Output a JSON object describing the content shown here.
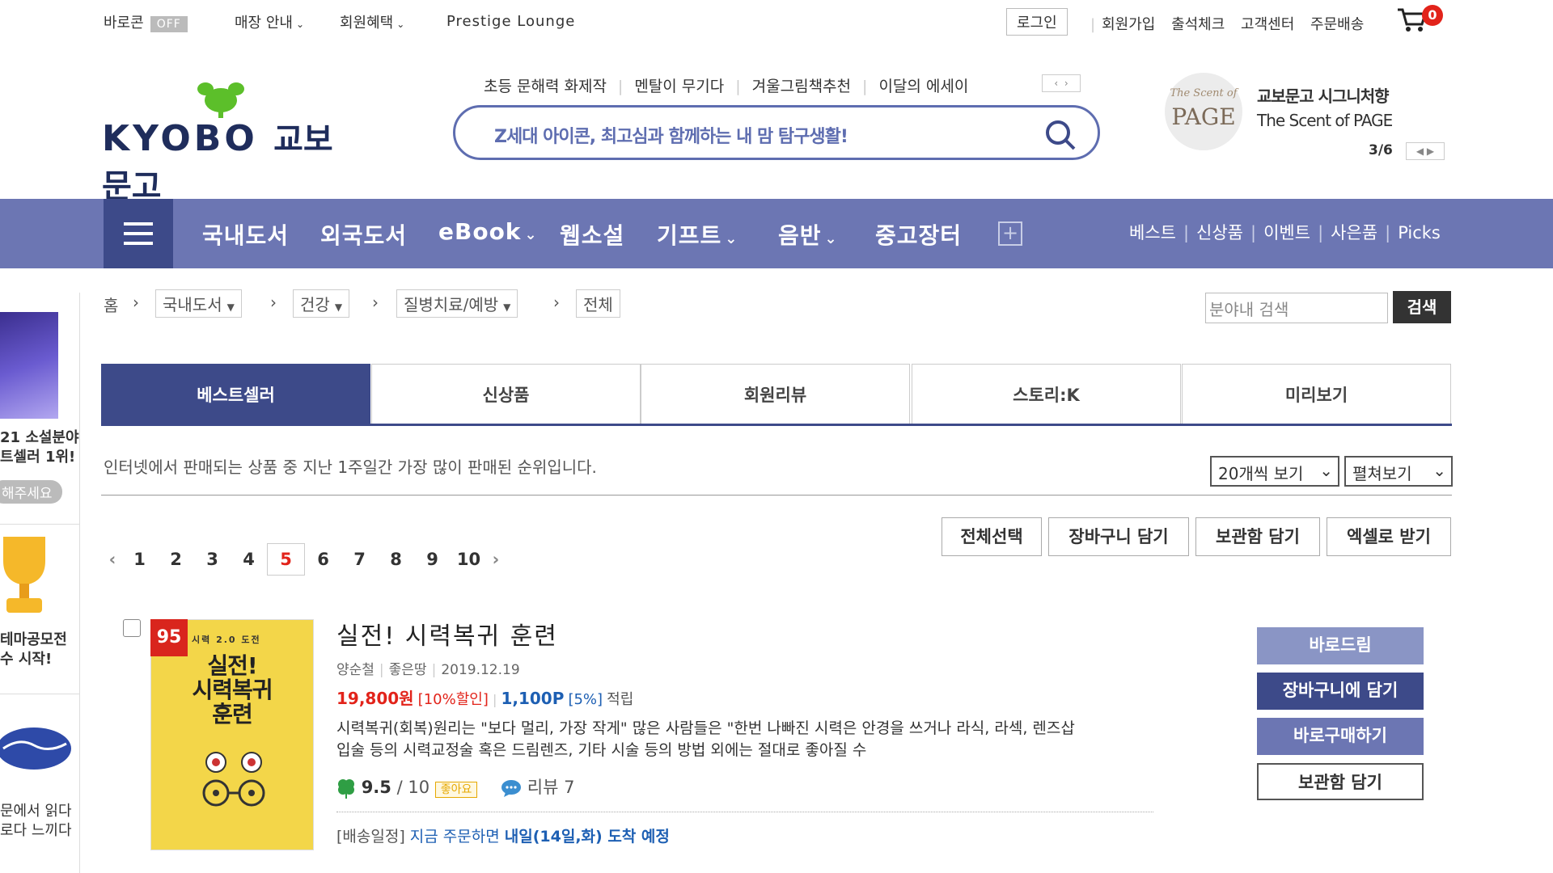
{
  "top_bar": {
    "barocon_label": "바로콘",
    "barocon_state": "OFF",
    "store_info": "매장 안내",
    "member_benefits": "회원혜택",
    "prestige": "Prestige Lounge",
    "login": "로그인",
    "signup": "회원가입",
    "attendance": "출석체크",
    "customer_center": "고객센터",
    "order_delivery": "주문배송",
    "cart_count": "0"
  },
  "header": {
    "logo_en": "KYOBO",
    "logo_ko": "교보문고",
    "hot_keywords": [
      "초등 문해력 화제작",
      "멘탈이 무기다",
      "겨울그림책추천",
      "이달의 에세이"
    ],
    "search_placeholder": "Z세대 아이콘, 최고심과 함께하는 내 맘 탐구생활!",
    "ad_line1": "교보문고 시그니처향",
    "ad_line2": "The Scent of PAGE",
    "ad_logo_top": "The Scent of",
    "ad_logo_main": "PAGE",
    "ad_pager": "3/6"
  },
  "nav": {
    "items": [
      "국내도서",
      "외국도서",
      "eBook",
      "웹소설",
      "기프트",
      "음반",
      "중고장터"
    ],
    "right_items": [
      "베스트",
      "신상품",
      "이벤트",
      "사은품",
      "Picks"
    ]
  },
  "breadcrumb": {
    "home": "홈",
    "level1": "국내도서",
    "level2": "건강",
    "level3": "질병치료/예방",
    "level4": "전체",
    "search_placeholder": "분야내 검색",
    "search_button": "검색"
  },
  "tabs": [
    "베스트셀러",
    "신상품",
    "회원리뷰",
    "스토리:K",
    "미리보기"
  ],
  "list": {
    "description": "인터넷에서 판매되는 상품 중 지난 1주일간 가장 많이 판매된 순위입니다.",
    "per_page": "20개씩 보기",
    "view_mode": "펼쳐보기",
    "actions": [
      "전체선택",
      "장바구니 담기",
      "보관함 담기",
      "엑셀로 받기"
    ],
    "pages": [
      "1",
      "2",
      "3",
      "4",
      "5",
      "6",
      "7",
      "8",
      "9",
      "10"
    ],
    "current_page": "5"
  },
  "left_side": {
    "banner1_line1": "21 소설분야",
    "banner1_line2": "트셀러 1위!",
    "banner1_button": "해주세요",
    "banner2_line1": "테마공모전",
    "banner2_line2": "수 시작!",
    "banner3_line1": "문에서 읽다",
    "banner3_line2": "로다 느끼다"
  },
  "product": {
    "rank": "95",
    "cover_series": "시력 2.0 도전",
    "cover_title_line1": "실전!",
    "cover_title_line2": "시력복귀",
    "cover_title_line3": "훈련",
    "title": "실전! 시력복귀 훈련",
    "author": "양순철",
    "publisher": "좋은땅",
    "date": "2019.12.19",
    "price": "19,800원",
    "discount": "[10%할인]",
    "points": "1,100P",
    "points_rate": "[5%]",
    "points_label": "적립",
    "desc_line1": "시력복귀(회복)원리는 \"보다 멀리, 가장 작게\" 많은 사람들은 \"한번 나빠진 시력은 안경을 쓰거나 라식, 라섹, 렌즈삽",
    "desc_line2": "입술 등의 시력교정술 혹은 드림렌즈, 기타 시술 등의 방법 외에는 절대로 좋아질 수",
    "rating": "9.5",
    "rating_max": "/ 10",
    "rating_badge": "좋아요",
    "review_label": "리뷰 7",
    "delivery_prefix": "[배송일정]",
    "delivery_text": "지금 주문하면",
    "delivery_date": "내일(14일,화) 도착 예정",
    "buttons": [
      "바로드림",
      "장바구니에 담기",
      "바로구매하기",
      "보관함 담기"
    ]
  },
  "colors": {
    "brand_navy": "#3d4a89",
    "nav_purple": "#6c76b3",
    "price_red": "#e2231a",
    "link_blue": "#1d5fb3",
    "logo_green": "#5cbf2a"
  }
}
